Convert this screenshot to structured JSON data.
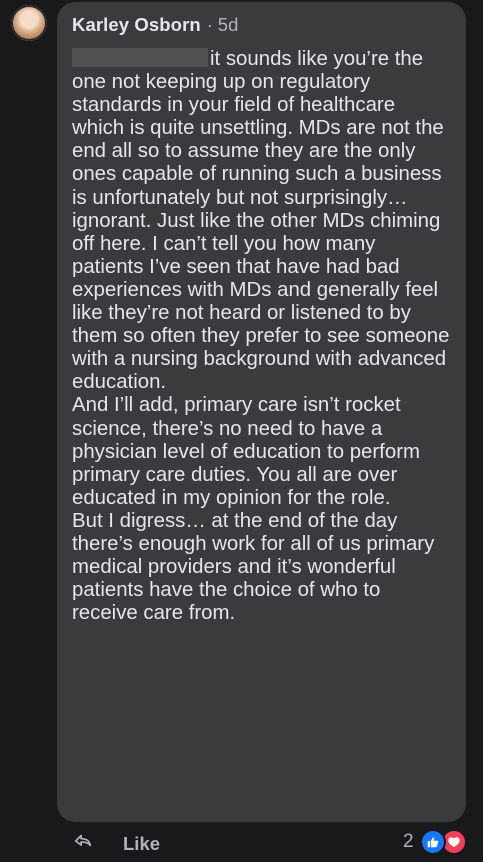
{
  "comment": {
    "author": "Karley Osborn",
    "separator": "·",
    "age": "5d",
    "paragraphs": [
      "it sounds like you’re the one not keeping up on regulatory standards in your field of healthcare which is quite unsettling. MDs are not the end all so to assume they are the only ones capable of running such a business is unfortunately but not surprisingly… ignorant. Just like the other MDs chiming off here. I can’t tell you how many patients I’ve seen that have had bad experiences with MDs and generally feel like they’re not heard or listened to by them so often they prefer to see someone with a nursing background with advanced education.",
      "And I’ll add, primary care isn’t rocket science, there’s no need to have a physician level of education to perform primary care duties. You all are over educated in my opinion for the role.",
      "But I digress… at the end of the day there’s enough work for all of us primary medical providers and it’s wonderful patients have the choice of who to receive care from."
    ]
  },
  "actions": {
    "like_label": "Like",
    "reaction_count": "2",
    "reactions": [
      "thumbs-up-icon",
      "heart-icon"
    ]
  },
  "colors": {
    "background": "#18191a",
    "bubble": "#3a3b3c",
    "text_primary": "#e4e6eb",
    "text_secondary": "#b0b3b8",
    "like_blue": "#1877f2",
    "love_red": "#f33e58"
  }
}
